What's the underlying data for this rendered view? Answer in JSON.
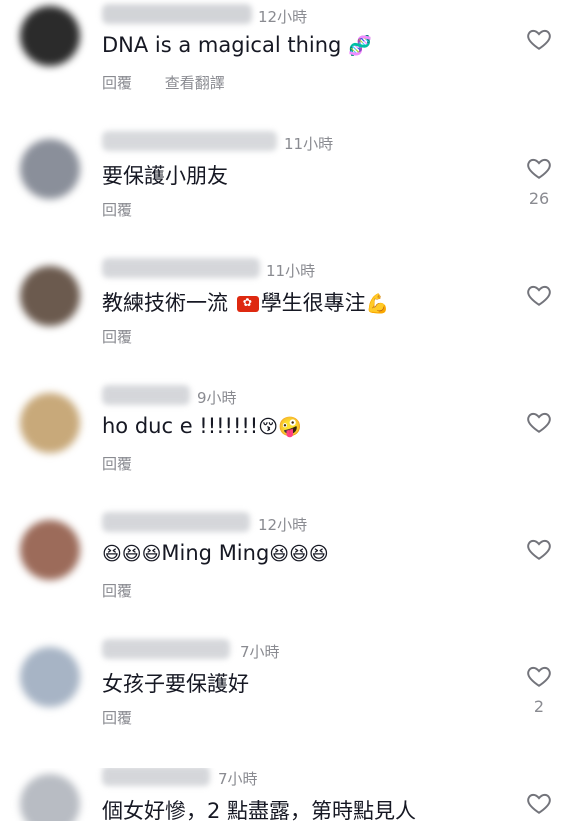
{
  "reply_label": "回覆",
  "colors": {
    "text": "#161823",
    "muted": "#8a8b91",
    "accent": "#8bc34a"
  },
  "comments": [
    {
      "time": "12小時",
      "text": "DNA is a magical thing",
      "emoji": "🧬",
      "translate": "查看翻譯",
      "likes": "",
      "avatar_color": "#2b2b2b"
    },
    {
      "time": "11小時",
      "text": "要保護小朋友",
      "emoji": "",
      "translate": "",
      "likes": "26",
      "avatar_color": "#8a8f9a"
    },
    {
      "time": "11小時",
      "text_before": "教練技術一流 ",
      "text_after": "學生很專注",
      "emoji": "💪",
      "translate": "",
      "likes": "",
      "avatar_color": "#6b5a4e"
    },
    {
      "time": "9小時",
      "text": "ho duc e !!!!!!!",
      "emoji": "😚🤪",
      "translate": "",
      "likes": "",
      "avatar_color": "#c8a97a"
    },
    {
      "time": "12小時",
      "text": "Ming Ming",
      "emoji_before": "😆😆😆",
      "emoji_after": "😆😆😆",
      "translate": "",
      "likes": "",
      "avatar_color": "#9c6b5a"
    },
    {
      "time": "7小時",
      "text": "女孩子要保護好",
      "emoji": "",
      "translate": "",
      "likes": "2",
      "avatar_color": "#a7b4c5"
    },
    {
      "time": "7小時",
      "text": "個女好慘，2 點盡露，第時點見人",
      "emoji": "",
      "translate": "",
      "likes": "",
      "avatar_color": "#b8bcc3"
    }
  ]
}
